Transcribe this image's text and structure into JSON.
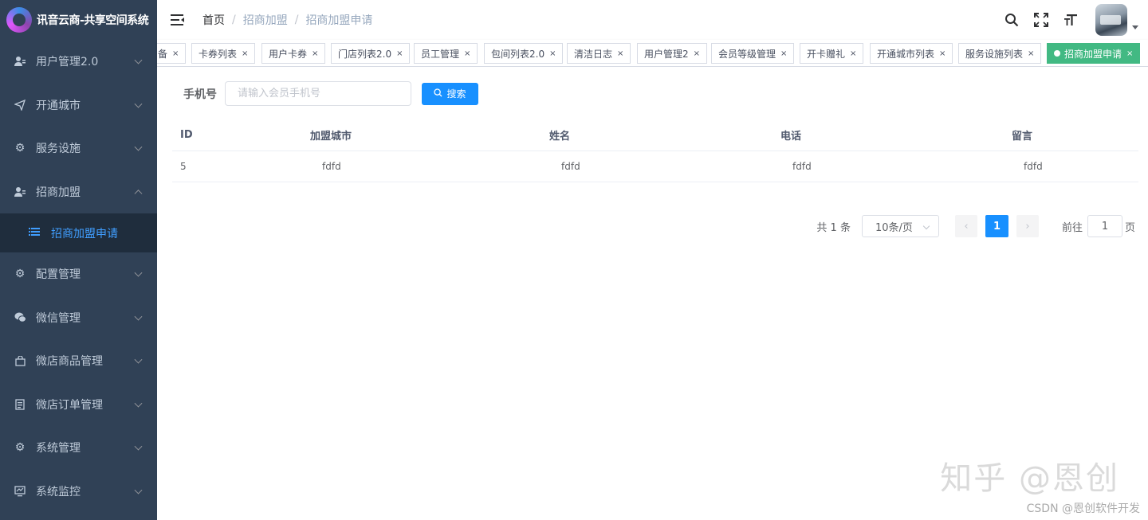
{
  "app": {
    "title": "讯音云商-共享空间系统"
  },
  "sidebar": {
    "items": [
      {
        "label": "用户管理2.0",
        "icon": "user-icon"
      },
      {
        "label": "开通城市",
        "icon": "send-icon"
      },
      {
        "label": "服务设施",
        "icon": "gear-icon"
      },
      {
        "label": "招商加盟",
        "icon": "user-icon",
        "expanded": true
      },
      {
        "label": "配置管理",
        "icon": "gear-icon"
      },
      {
        "label": "微信管理",
        "icon": "wechat-icon"
      },
      {
        "label": "微店商品管理",
        "icon": "bag-icon"
      },
      {
        "label": "微店订单管理",
        "icon": "document-icon"
      },
      {
        "label": "系统管理",
        "icon": "gear-icon"
      },
      {
        "label": "系统监控",
        "icon": "monitor-icon"
      }
    ],
    "submenu": {
      "label": "招商加盟申请",
      "icon": "list-icon"
    }
  },
  "breadcrumb": {
    "home": "首页",
    "parent": "招商加盟",
    "current": "招商加盟申请",
    "separator": "/"
  },
  "tags": [
    {
      "label": "备"
    },
    {
      "label": "卡券列表"
    },
    {
      "label": "用户卡券"
    },
    {
      "label": "门店列表2.0"
    },
    {
      "label": "员工管理"
    },
    {
      "label": "包间列表2.0"
    },
    {
      "label": "清洁日志"
    },
    {
      "label": "用户管理2"
    },
    {
      "label": "会员等级管理"
    },
    {
      "label": "开卡赠礼"
    },
    {
      "label": "开通城市列表"
    },
    {
      "label": "服务设施列表"
    },
    {
      "label": "招商加盟申请",
      "active": true
    }
  ],
  "tag_close": "×",
  "search": {
    "label": "手机号",
    "placeholder": "请输入会员手机号",
    "button": "搜索"
  },
  "table": {
    "columns": [
      "ID",
      "加盟城市",
      "姓名",
      "电话",
      "留言"
    ],
    "rows": [
      [
        "5",
        "fdfd",
        "fdfd",
        "fdfd",
        "fdfd"
      ]
    ]
  },
  "pagination": {
    "total": "共 1 条",
    "page_size": "10条/页",
    "current_page": "1",
    "goto_label": "前往",
    "goto_value": "1",
    "page_unit": "页"
  },
  "watermark": {
    "main": "知乎 @恩创",
    "sub": "CSDN @恩创软件开发"
  },
  "colors": {
    "sidebar": "#304156",
    "active_tag": "#42b983",
    "primary": "#1890ff"
  }
}
